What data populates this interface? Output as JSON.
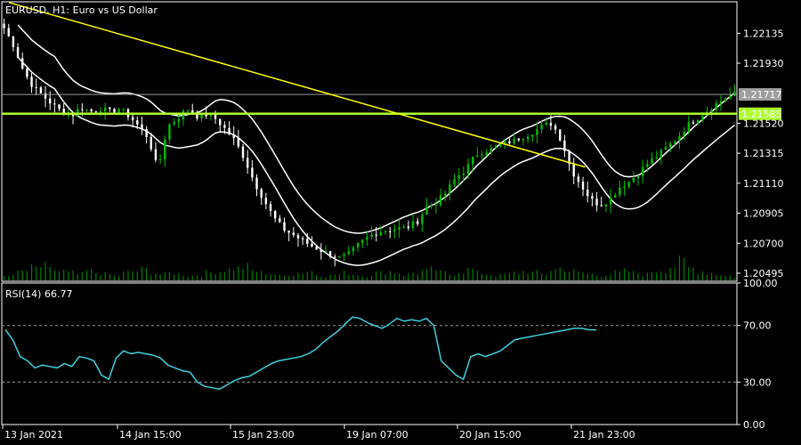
{
  "header": {
    "symbol_line": "EURUSD, H1:  Euro vs US Dollar",
    "rsi_label": "RSI(14) 66.77"
  },
  "colors": {
    "background": "#000000",
    "frame": "#ffffff",
    "bull_candle": "#00c000",
    "bear_candle": "#ffffff",
    "trendline": "#ffff00",
    "hline": "#adff2f",
    "envelope": "#ffffff",
    "rsi_line": "#40d0e0",
    "level_line": "#9e9e9e",
    "bid_line": "#9e9e9e",
    "volume": "#008000"
  },
  "chart_data": [
    {
      "type": "candlestick",
      "title": "EURUSD, H1:  Euro vs US Dollar",
      "ylim": [
        1.2044,
        1.2235
      ],
      "y_ticks": [
        "1.22135",
        "1.21930",
        "1.21520",
        "1.21315",
        "1.21110",
        "1.20905",
        "1.20700",
        "1.20495"
      ],
      "x_ticks": [
        "13 Jan 2021",
        "14 Jan 15:00",
        "15 Jan 23:00",
        "19 Jan 07:00",
        "20 Jan 15:00",
        "21 Jan 23:00"
      ],
      "current_price": "1.21717",
      "horizontal_line": "1.21585",
      "close_path": [
        [
          0,
          1.2217
        ],
        [
          4,
          1.2205
        ],
        [
          8,
          1.2188
        ],
        [
          12,
          1.2177
        ],
        [
          16,
          1.2171
        ],
        [
          20,
          1.2165
        ],
        [
          24,
          1.216
        ],
        [
          28,
          1.2157
        ],
        [
          32,
          1.2163
        ],
        [
          36,
          1.216
        ],
        [
          40,
          1.2162
        ],
        [
          44,
          1.216
        ],
        [
          48,
          1.2162
        ],
        [
          52,
          1.2157
        ],
        [
          56,
          1.215
        ],
        [
          60,
          1.2142
        ],
        [
          64,
          1.212
        ],
        [
          68,
          1.215
        ],
        [
          72,
          1.2155
        ],
        [
          76,
          1.2162
        ],
        [
          80,
          1.2157
        ],
        [
          84,
          1.2158
        ],
        [
          88,
          1.2155
        ],
        [
          92,
          1.2148
        ],
        [
          96,
          1.214
        ],
        [
          100,
          1.2128
        ],
        [
          104,
          1.2112
        ],
        [
          108,
          1.21
        ],
        [
          112,
          1.2088
        ],
        [
          116,
          1.208
        ],
        [
          120,
          1.2076
        ],
        [
          124,
          1.2072
        ],
        [
          128,
          1.2068
        ],
        [
          132,
          1.2065
        ],
        [
          136,
          1.2062
        ],
        [
          140,
          1.206
        ],
        [
          144,
          1.2063
        ],
        [
          148,
          1.207
        ],
        [
          152,
          1.2075
        ],
        [
          156,
          1.2078
        ],
        [
          160,
          1.2079
        ],
        [
          164,
          1.208
        ],
        [
          168,
          1.2081
        ],
        [
          172,
          1.2085
        ],
        [
          176,
          1.2095
        ],
        [
          180,
          1.2098
        ],
        [
          184,
          1.2105
        ],
        [
          188,
          1.2115
        ],
        [
          192,
          1.212
        ],
        [
          196,
          1.213
        ],
        [
          200,
          1.2133
        ],
        [
          204,
          1.2135
        ],
        [
          208,
          1.2138
        ],
        [
          212,
          1.214
        ],
        [
          216,
          1.2143
        ],
        [
          220,
          1.2146
        ],
        [
          224,
          1.215
        ],
        [
          228,
          1.2152
        ],
        [
          232,
          1.214
        ],
        [
          236,
          1.212
        ],
        [
          240,
          1.211
        ],
        [
          244,
          1.21
        ],
        [
          248,
          1.2096
        ],
        [
          252,
          1.21
        ],
        [
          256,
          1.2108
        ],
        [
          260,
          1.2112
        ],
        [
          264,
          1.2118
        ],
        [
          268,
          1.2125
        ],
        [
          272,
          1.213
        ],
        [
          276,
          1.2136
        ],
        [
          280,
          1.2142
        ],
        [
          284,
          1.215
        ],
        [
          288,
          1.2155
        ],
        [
          292,
          1.216
        ],
        [
          296,
          1.2165
        ],
        [
          300,
          1.2169
        ],
        [
          304,
          1.2172
        ]
      ],
      "volume": [
        3,
        5,
        6,
        8,
        9,
        7,
        6,
        5,
        4,
        6,
        5,
        4,
        3,
        5,
        6,
        7,
        5,
        4,
        5,
        4,
        3,
        4,
        5,
        6,
        7,
        8,
        9,
        6,
        5,
        4,
        3,
        4,
        5,
        6,
        4,
        3,
        4,
        5,
        4,
        3,
        4,
        5,
        6,
        5,
        4,
        5,
        6,
        7,
        5,
        4,
        6,
        7,
        5,
        4,
        3,
        4,
        5,
        6,
        5,
        4,
        7,
        8,
        6,
        5,
        4,
        3,
        4,
        5,
        6,
        5,
        4,
        6,
        7,
        9,
        12,
        8,
        6,
        5,
        4,
        3,
        2
      ]
    },
    {
      "type": "line",
      "title": "RSI(14) 66.77",
      "ylim": [
        0,
        100
      ],
      "y_ticks": [
        "100.00",
        "70.00",
        "30.00",
        "0.00"
      ],
      "levels": [
        70,
        30
      ],
      "values": [
        67,
        60,
        48,
        45,
        40,
        42,
        41,
        40,
        43,
        41,
        48,
        47,
        45,
        35,
        32,
        47,
        52,
        50,
        51,
        50,
        49,
        47,
        42,
        40,
        38,
        37,
        30,
        27,
        26,
        25,
        28,
        31,
        33,
        34,
        37,
        40,
        43,
        45,
        46,
        47,
        48,
        50,
        53,
        58,
        62,
        66,
        71,
        76,
        75,
        72,
        70,
        68,
        71,
        75,
        73,
        74,
        73,
        75,
        70,
        45,
        40,
        35,
        32,
        48,
        50,
        48,
        50,
        52,
        56,
        60,
        61,
        62,
        63,
        64,
        65,
        66,
        67,
        68,
        68,
        67,
        66.77
      ]
    }
  ]
}
